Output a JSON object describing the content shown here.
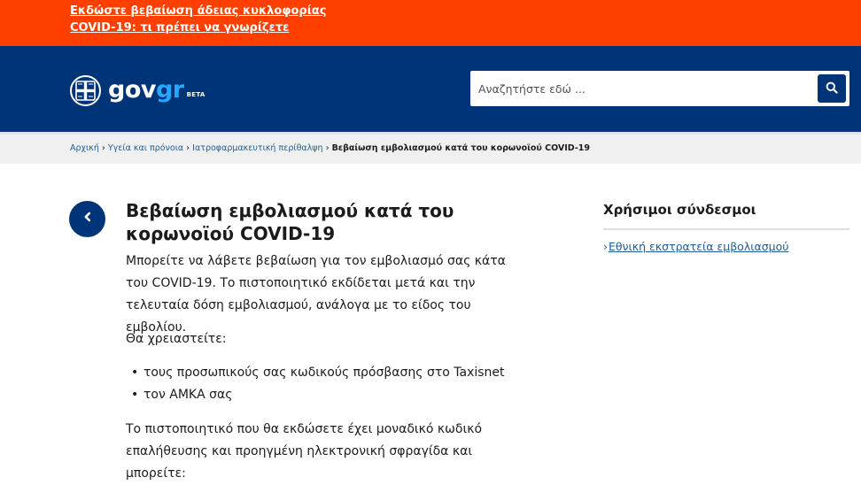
{
  "alert": {
    "link_text": "Εκδώστε βεβαίωση άδειας κυκλοφορίας COVID-19: τι πρέπει να γνωρίζετε"
  },
  "header": {
    "logo_prefix": "gov",
    "logo_suffix": "gr",
    "logo_badge": "BETA",
    "search_placeholder": "Αναζητήστε εδώ ..."
  },
  "breadcrumb": {
    "items": [
      "Αρχική",
      "Υγεία και πρόνοια",
      "Ιατροφαρμακευτική περίθαλψη"
    ],
    "current": "Βεβαίωση εμβολιασμού κατά του κορωνοϊού COVID-19"
  },
  "main": {
    "title": "Βεβαίωση εμβολιασμού κατά του κορωνοϊού COVID-19",
    "intro": "Μπορείτε να λάβετε βεβαίωση για τον εμβολιασμό σας κάτα του COVID-19. Το πιστοποιητικό εκδίδεται μετά και την τελευταία δόση εμβολιασμού, ανάλογα με το είδος του εμβολίου.",
    "need_label": "Θα χρειαστείτε:",
    "requirements": [
      "τους προσωπικούς σας κωδικούς πρόσβασης στο Taxisnet",
      "τον ΑΜΚΑ σας"
    ],
    "certificate_text": "Το πιστοποιητικό που θα εκδώσετε έχει μοναδικό κωδικό επαλήθευσης και προηγμένη ηλεκτρονική σφραγίδα και μπορείτε:"
  },
  "sidebar": {
    "title": "Χρήσιμοι σύνδεσμοι",
    "chevron": "›",
    "links": [
      "Εθνική εκστρατεία εμβολιασμού"
    ]
  },
  "colors": {
    "alert_bg": "#ff3f00",
    "header_bg": "#003479",
    "link": "#1d5c96",
    "logo_accent": "#2aa6ff"
  },
  "icons": {
    "emblem": "greek-emblem-icon",
    "search": "search-icon",
    "back": "chevron-left-icon",
    "breadcrumb_separator": "chevron-right-icon"
  }
}
